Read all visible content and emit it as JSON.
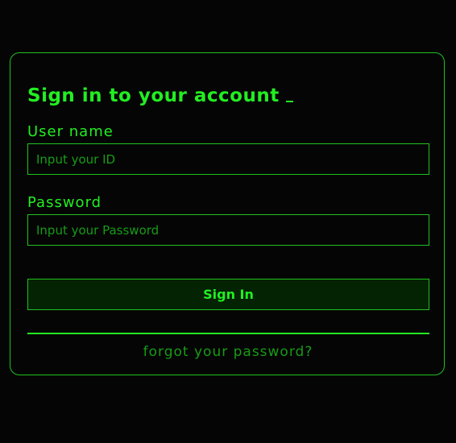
{
  "form": {
    "title": "Sign in to your account",
    "username_label": "User name",
    "username_placeholder": "Input your ID",
    "username_value": "",
    "password_label": "Password",
    "password_placeholder": "Input your Password",
    "password_value": "",
    "submit_label": "Sign In",
    "forgot_link": "forgot your password?"
  },
  "colors": {
    "accent": "#22ee22",
    "dim_accent": "#169c16",
    "border": "#1fc21f",
    "background": "#050505",
    "button_bg": "#032303"
  }
}
